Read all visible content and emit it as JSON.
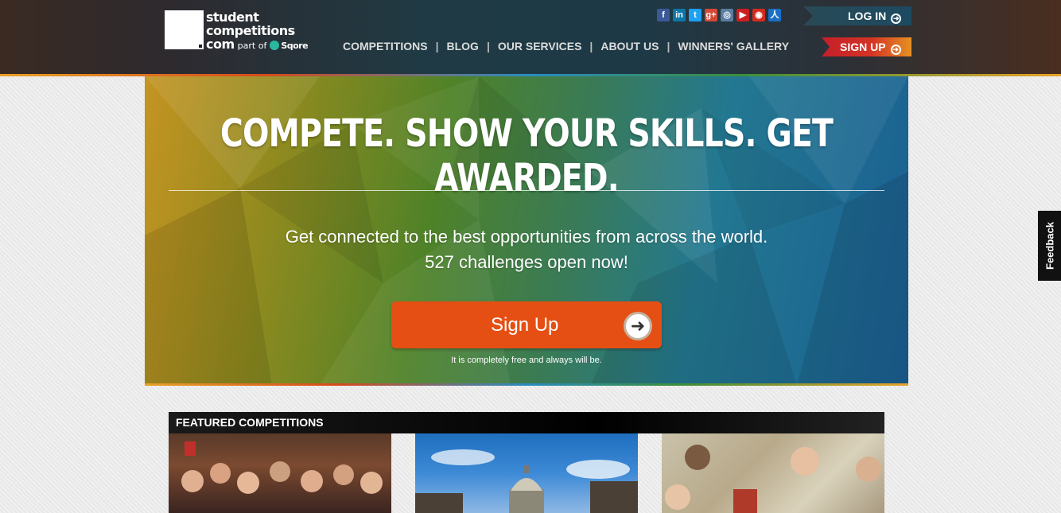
{
  "header": {
    "logo": {
      "line1": "student",
      "line2": "competitions",
      "line3": "com",
      "part_of": "part of",
      "sqore": "Sqore"
    },
    "nav": [
      "COMPETITIONS",
      "BLOG",
      "OUR SERVICES",
      "ABOUT US",
      "WINNERS' GALLERY"
    ],
    "nav_separator": "|",
    "social_icons": [
      {
        "name": "facebook-icon",
        "glyph": "f",
        "color": "#3b5998"
      },
      {
        "name": "linkedin-icon",
        "glyph": "in",
        "color": "#0e76a8"
      },
      {
        "name": "twitter-icon",
        "glyph": "t",
        "color": "#1da1f2"
      },
      {
        "name": "googleplus-icon",
        "glyph": "g+",
        "color": "#d34836"
      },
      {
        "name": "instagram-icon",
        "glyph": "◎",
        "color": "#5a7da0"
      },
      {
        "name": "youtube-icon",
        "glyph": "▶",
        "color": "#cc1f1f"
      },
      {
        "name": "weibo-icon",
        "glyph": "◉",
        "color": "#d52b1e"
      },
      {
        "name": "renren-icon",
        "glyph": "人",
        "color": "#1a6fc4"
      }
    ],
    "login_label": "LOG IN",
    "signup_label": "SIGN UP"
  },
  "hero": {
    "title": "COMPETE. SHOW YOUR SKILLS. GET AWARDED.",
    "subtitle_line1": "Get connected to the best opportunities from across the world.",
    "subtitle_line2": "527 challenges open now!",
    "button_label": "Sign Up",
    "note": "It is completely free and always will be."
  },
  "feedback_label": "Feedback",
  "featured": {
    "heading": "FEATURED COMPETITIONS"
  },
  "colors": {
    "accent_orange": "#e64f13",
    "login_bg": "#1c4a62",
    "signup_bg": "#d43325"
  }
}
